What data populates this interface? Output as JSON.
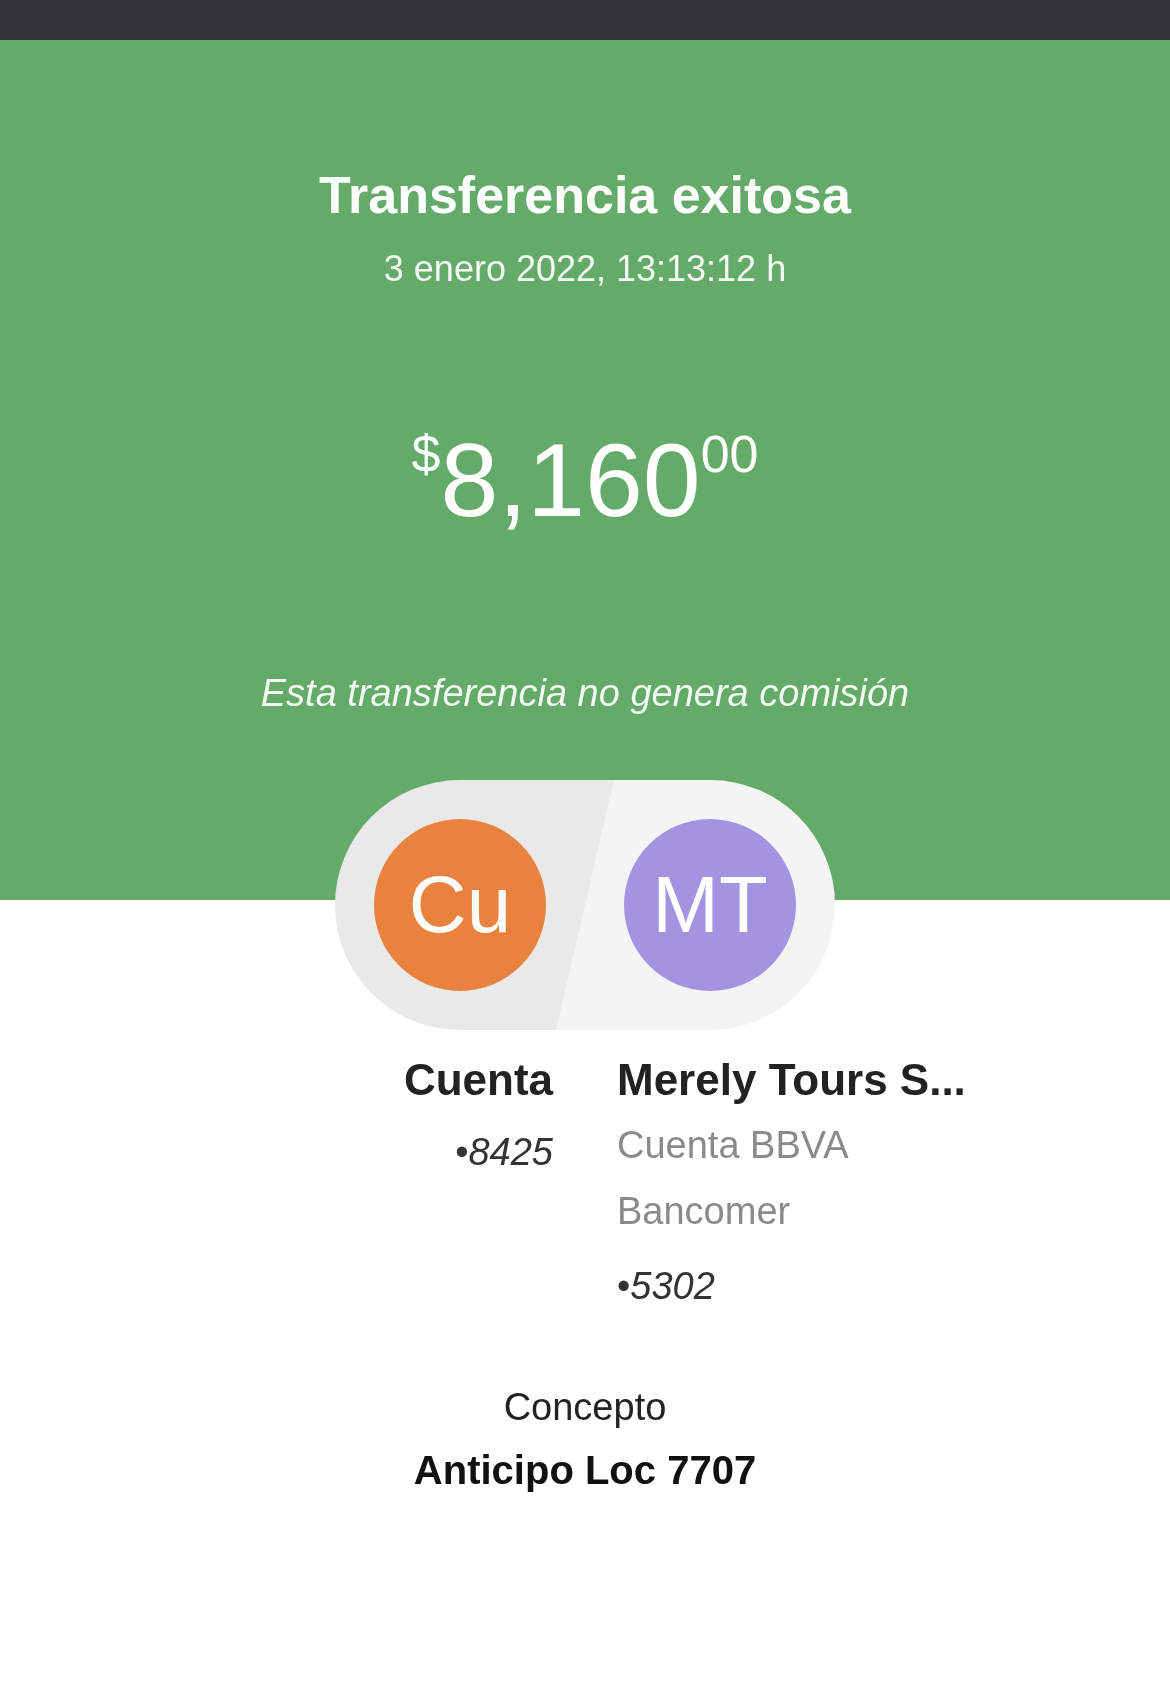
{
  "header": {
    "title": "Transferencia exitosa",
    "datetime": "3 enero 2022, 13:13:12 h",
    "amount": {
      "currency": "$",
      "integer": "8,160",
      "cents": "00"
    },
    "note": "Esta transferencia no genera comisión"
  },
  "parties": [
    {
      "initials": "Cu",
      "name": "Cuenta",
      "account": "•*8425*",
      "color": "#e8823e"
    },
    {
      "initials": "MT",
      "name": "Merely Tours S...",
      "bank": "Cuenta BBVA Bancomer",
      "account": "•*5302*",
      "color": "#a394e2"
    }
  ],
  "concept": {
    "label": "Concepto",
    "value": "Anticipo Loc 7707"
  }
}
